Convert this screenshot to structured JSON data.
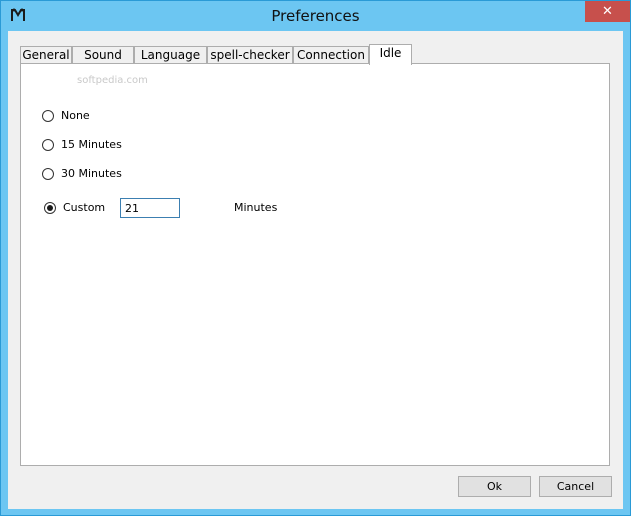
{
  "window": {
    "title": "Preferences",
    "close_glyph": "✕"
  },
  "tabs": [
    {
      "label": "General"
    },
    {
      "label": "Sound"
    },
    {
      "label": "Language"
    },
    {
      "label": "spell-checker"
    },
    {
      "label": "Connection"
    },
    {
      "label": "Idle",
      "active": true
    }
  ],
  "watermark": "softpedia.com",
  "idle": {
    "options": [
      {
        "label": "None",
        "selected": false
      },
      {
        "label": "15 Minutes",
        "selected": false
      },
      {
        "label": "30 Minutes",
        "selected": false
      },
      {
        "label": "Custom",
        "selected": true
      }
    ],
    "custom_value": "21",
    "units_label": "Minutes"
  },
  "buttons": {
    "ok": "Ok",
    "cancel": "Cancel"
  },
  "icons": {
    "app": "app-icon",
    "close": "close-icon",
    "radio": "radio-button-icon"
  },
  "colors": {
    "frame": "#6cc6f2",
    "close_button": "#c7504c",
    "panel_bg": "#ffffff",
    "client_bg": "#f0f0f0"
  }
}
